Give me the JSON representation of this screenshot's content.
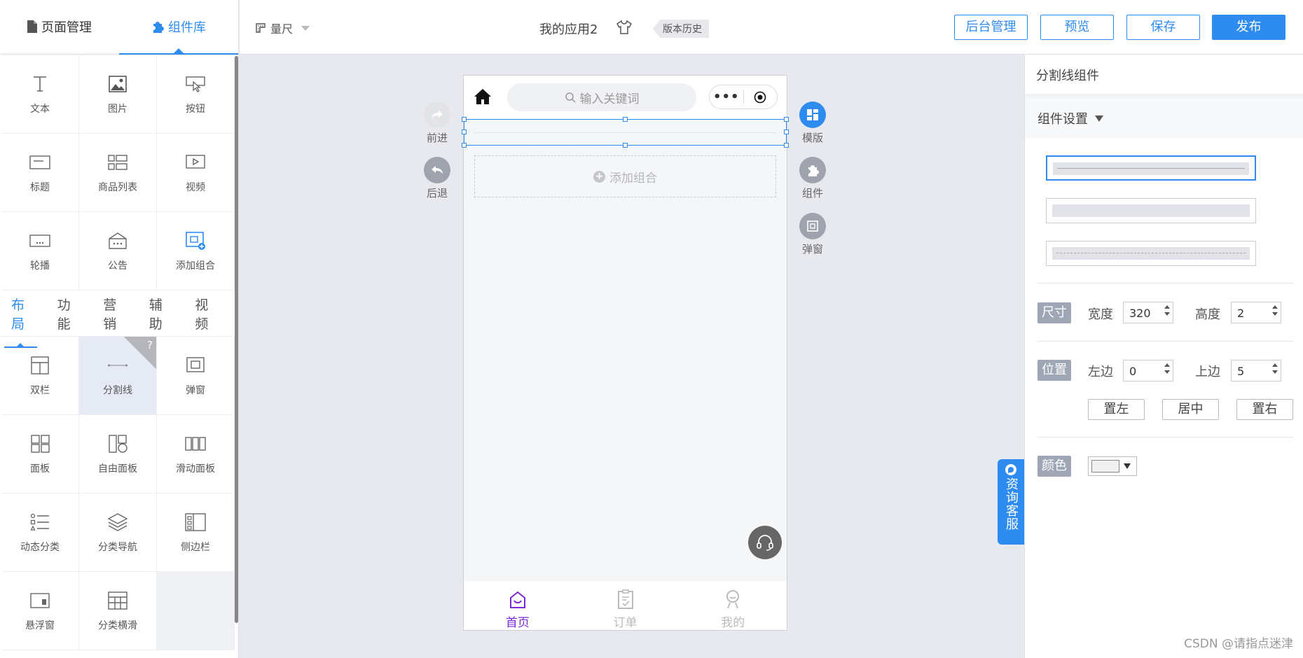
{
  "left_tabs": [
    {
      "label": "页面管理",
      "icon": "page-icon",
      "active": false
    },
    {
      "label": "组件库",
      "icon": "puzzle-icon",
      "active": true
    }
  ],
  "basic_components": [
    {
      "label": "文本",
      "icon": "text-icon"
    },
    {
      "label": "图片",
      "icon": "image-icon"
    },
    {
      "label": "按钮",
      "icon": "button-icon"
    },
    {
      "label": "标题",
      "icon": "title-icon"
    },
    {
      "label": "商品列表",
      "icon": "product-list-icon"
    },
    {
      "label": "视频",
      "icon": "video-icon"
    },
    {
      "label": "轮播",
      "icon": "carousel-icon"
    },
    {
      "label": "公告",
      "icon": "notice-icon"
    },
    {
      "label": "添加组合",
      "icon": "add-group-icon"
    }
  ],
  "category_tabs": [
    "布局",
    "功能",
    "营销",
    "辅助",
    "视频"
  ],
  "active_category": "布局",
  "layout_components": [
    {
      "label": "双栏",
      "icon": "two-column-icon"
    },
    {
      "label": "分割线",
      "icon": "divider-icon",
      "selected": true,
      "help": "?"
    },
    {
      "label": "弹窗",
      "icon": "popup-icon"
    },
    {
      "label": "面板",
      "icon": "panel-icon"
    },
    {
      "label": "自由面板",
      "icon": "free-panel-icon"
    },
    {
      "label": "滑动面板",
      "icon": "slide-panel-icon"
    },
    {
      "label": "动态分类",
      "icon": "dynamic-category-icon"
    },
    {
      "label": "分类导航",
      "icon": "category-nav-icon"
    },
    {
      "label": "侧边栏",
      "icon": "sidebar-icon"
    },
    {
      "label": "悬浮窗",
      "icon": "float-window-icon"
    },
    {
      "label": "分类横滑",
      "icon": "category-scroll-icon"
    }
  ],
  "topbar": {
    "ruler": "量尺",
    "app_name": "我的应用2",
    "history": "版本历史",
    "buttons": {
      "admin": "后台管理",
      "preview": "预览",
      "save": "保存",
      "publish": "发布"
    }
  },
  "phone": {
    "search_placeholder": "输入关键词",
    "capsule_dots": "•••",
    "add_group": "添加组合",
    "tabbar": [
      {
        "label": "首页",
        "icon": "home-tab-icon",
        "active": true
      },
      {
        "label": "订单",
        "icon": "order-tab-icon",
        "active": false
      },
      {
        "label": "我的",
        "icon": "profile-tab-icon",
        "active": false
      }
    ]
  },
  "side_left": {
    "forward": "前进",
    "back": "后退"
  },
  "side_right": {
    "template": "模版",
    "component": "组件",
    "popup": "弹窗"
  },
  "consult": "资询客服",
  "right_panel": {
    "title": "分割线组件",
    "settings": "组件设置",
    "size_tag": "尺寸",
    "width_label": "宽度",
    "width_value": "320",
    "height_label": "高度",
    "height_value": "2",
    "position_tag": "位置",
    "left_label": "左边",
    "left_value": "0",
    "top_label": "上边",
    "top_value": "5",
    "align_left": "置左",
    "align_center": "居中",
    "align_right": "置右",
    "color_tag": "颜色"
  },
  "colors": {
    "accent": "#2e8cf0",
    "tab_active": "#7a2bd6",
    "tag_bg": "#9fa6b5"
  },
  "watermark": "CSDN @请指点迷津"
}
